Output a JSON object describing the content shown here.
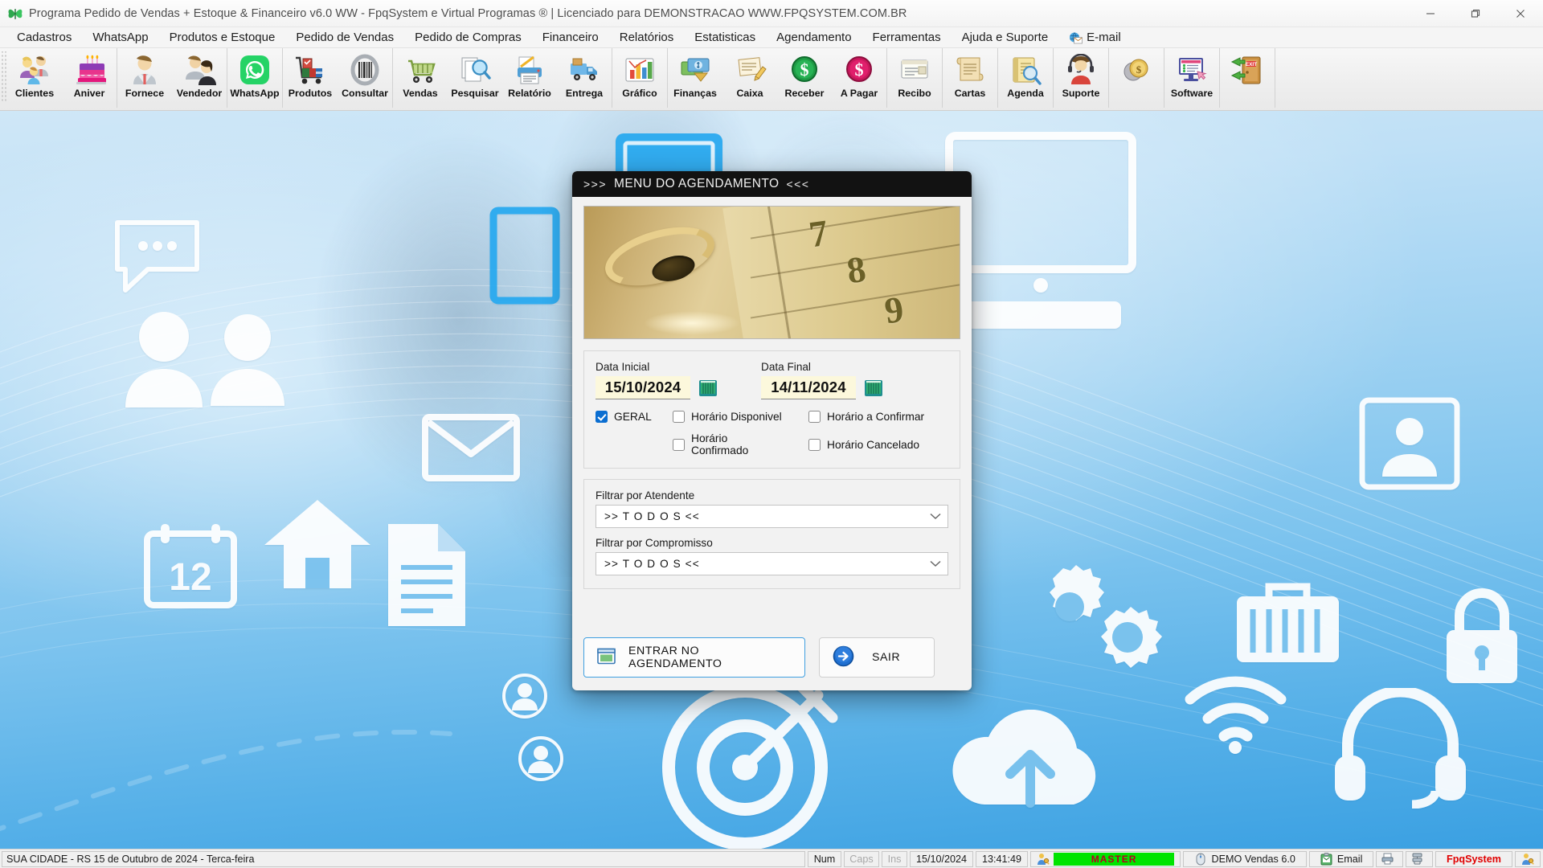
{
  "window": {
    "title": "Programa Pedido de Vendas + Estoque & Financeiro v6.0 WW - FpqSystem e Virtual Programas ® | Licenciado para  DEMONSTRACAO WWW.FPQSYSTEM.COM.BR",
    "app_icon": "butterfly-icon",
    "controls": {
      "minimize": "minimize-icon",
      "maximize": "maximize-icon",
      "close": "close-icon"
    }
  },
  "menubar": [
    {
      "label": "Cadastros",
      "accel": "C"
    },
    {
      "label": "WhatsApp",
      "accel": "W"
    },
    {
      "label": "Produtos e Estoque",
      "accel": "P"
    },
    {
      "label": "Pedido de Vendas",
      "accel": "P"
    },
    {
      "label": "Pedido de Compras",
      "accel": "P"
    },
    {
      "label": "Financeiro",
      "accel": ""
    },
    {
      "label": "Relatórios",
      "accel": ""
    },
    {
      "label": "Estatisticas",
      "accel": ""
    },
    {
      "label": "Agendamento",
      "accel": "A"
    },
    {
      "label": "Ferramentas",
      "accel": ""
    },
    {
      "label": "Ajuda e Suporte",
      "accel": ""
    },
    {
      "label": "E-mail",
      "accel": "",
      "icon": "email-globe-icon"
    }
  ],
  "toolbar": {
    "groups": [
      {
        "buttons": [
          {
            "label": "Clientes",
            "icon": "clients-people-icon"
          },
          {
            "label": "Aniver",
            "icon": "birthday-cake-icon"
          }
        ]
      },
      {
        "buttons": [
          {
            "label": "Fornece",
            "icon": "supplier-person-icon"
          },
          {
            "label": "Vendedor",
            "icon": "salesperson-couple-icon"
          }
        ]
      },
      {
        "buttons": [
          {
            "label": "WhatsApp",
            "icon": "whatsapp-icon"
          }
        ]
      },
      {
        "buttons": [
          {
            "label": "Produtos",
            "icon": "products-cart-icon"
          },
          {
            "label": "Consultar",
            "icon": "barcode-icon"
          }
        ]
      },
      {
        "buttons": [
          {
            "label": "Vendas",
            "icon": "shopping-cart-icon"
          },
          {
            "label": "Pesquisar",
            "icon": "search-documents-icon"
          },
          {
            "label": "Relatório",
            "icon": "report-printer-icon"
          },
          {
            "label": "Entrega",
            "icon": "delivery-truck-icon"
          }
        ]
      },
      {
        "buttons": [
          {
            "label": "Gráfico",
            "icon": "bar-chart-icon"
          }
        ]
      },
      {
        "buttons": [
          {
            "label": "Finanças",
            "icon": "finance-money-icon"
          },
          {
            "label": "Caixa",
            "icon": "cash-register-icon"
          },
          {
            "label": "Receber",
            "icon": "receivable-green-dollar-icon"
          },
          {
            "label": "A Pagar",
            "icon": "payable-pink-dollar-icon"
          }
        ]
      },
      {
        "buttons": [
          {
            "label": "Recibo",
            "icon": "receipt-icon"
          }
        ]
      },
      {
        "buttons": [
          {
            "label": "Cartas",
            "icon": "letters-scroll-icon"
          }
        ]
      },
      {
        "buttons": [
          {
            "label": "Agenda",
            "icon": "agenda-magnifier-icon"
          }
        ]
      },
      {
        "buttons": [
          {
            "label": "Suporte",
            "icon": "support-headset-icon"
          }
        ]
      },
      {
        "buttons": [
          {
            "label": "",
            "icon": "coins-icon"
          }
        ]
      },
      {
        "buttons": [
          {
            "label": "Software",
            "icon": "software-monitor-icon"
          }
        ]
      },
      {
        "buttons": [
          {
            "label": "",
            "icon": "exit-door-icon"
          }
        ]
      }
    ]
  },
  "dialog": {
    "title": "MENU DO AGENDAMENTO",
    "title_prefix": ">>>",
    "title_suffix": "<<<",
    "hero": {
      "icon": "planner-notebook-photo",
      "numbers": [
        "7",
        "8",
        "9"
      ]
    },
    "date_start": {
      "label": "Data Inicial",
      "value": "15/10/2024",
      "calendar_icon": "calendar-icon"
    },
    "date_end": {
      "label": "Data Final",
      "value": "14/11/2024",
      "calendar_icon": "calendar-icon"
    },
    "checkboxes": [
      {
        "label": "GERAL",
        "checked": true
      },
      {
        "label": "Horário  Disponivel",
        "checked": false
      },
      {
        "label": "Horário a Confirmar",
        "checked": false
      },
      {
        "label": "Horário Confirmado",
        "checked": false
      },
      {
        "label": "Horário Cancelado",
        "checked": false
      }
    ],
    "filter_attendant": {
      "label": "Filtrar por Atendente",
      "value": ">> T O D O S <<"
    },
    "filter_commitment": {
      "label": "Filtrar por Compromisso",
      "value": ">> T O D O S <<"
    },
    "buttons": [
      {
        "label": "ENTRAR NO AGENDAMENTO",
        "icon": "window-open-icon",
        "primary": true
      },
      {
        "label": "SAIR",
        "icon": "exit-arrow-icon",
        "primary": false
      }
    ]
  },
  "statusbar": {
    "message": "SUA CIDADE - RS 15 de Outubro de 2024 - Terca-feira",
    "num": "Num",
    "caps": "Caps",
    "ins": "Ins",
    "date": "15/10/2024",
    "time": "13:41:49",
    "user_badge": "MASTER",
    "user_icon": "user-key-icon",
    "company": "DEMO Vendas 6.0",
    "company_icon": "mouse-icon",
    "email": "Email",
    "email_icon": "email-clipboard-icon",
    "printer_icon": "printer-icon",
    "network_icon": "network-icon",
    "brand": "FpqSystem",
    "brand_icon": "user-key-icon-2"
  },
  "colors": {
    "accent_blue": "#3aa0e2",
    "dialog_title_bg": "#121212",
    "date_field_bg": "#fcf8dc",
    "checkbox_checked": "#0b6ed1",
    "status_green": "#00e400",
    "status_red": "#b4001e",
    "brand_red": "#e00000"
  }
}
